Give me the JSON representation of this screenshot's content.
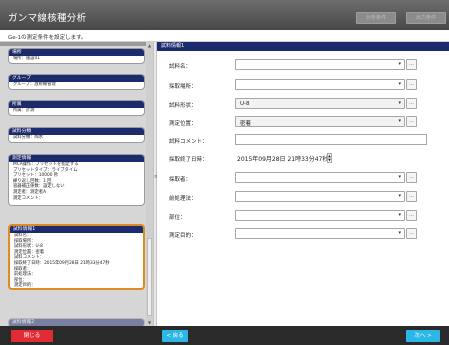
{
  "header": {
    "title": "ガンマ線核種分析",
    "buttons": [
      "分析条件",
      "出力条件"
    ]
  },
  "subheader": "Ge-1の測定条件を設定します。",
  "left_panel": {
    "cards": [
      {
        "title": "場所",
        "lines": [
          "場所：施設01"
        ]
      },
      {
        "title": "グループ",
        "lines": [
          "グループ：放射線管理"
        ]
      },
      {
        "title": "所属",
        "lines": [
          "所属：計測"
        ]
      },
      {
        "title": "試料分類",
        "lines": [
          "試料分類：陶水"
        ]
      },
      {
        "title": "測定情報",
        "lines": [
          "MCA操作：プリセットを指定する",
          "プリセットタイプ：ライブタイム",
          "プリセット：10000 秒",
          "繰り返し回数：1 回",
          "容器補正係数：設定しない",
          "測定者：測定者A",
          "測定コメント："
        ]
      },
      {
        "title": "試料情報1",
        "lines": [
          "試料名：",
          "採取場所：",
          "試料形状：U-8",
          "測定位置：密着",
          "試料コメント：",
          "採取終了日時：2015年09月28日 21時33分47秒",
          "採取者：",
          "前処理法：",
          "部位：",
          "測定目的："
        ]
      },
      {
        "title": "試料情報2",
        "lines": []
      }
    ]
  },
  "right_panel": {
    "title": "試料情報1",
    "fields": [
      {
        "label": "試料名：",
        "value": ""
      },
      {
        "label": "採取場所：",
        "value": ""
      },
      {
        "label": "試料形状：",
        "value": "U-8"
      },
      {
        "label": "測定位置：",
        "value": "密着"
      },
      {
        "label": "試料コメント：",
        "value": ""
      },
      {
        "label": "採取終了日時：",
        "value": "2015年09月28日 21時33分47秒"
      },
      {
        "label": "採取者：",
        "value": ""
      },
      {
        "label": "前処理法：",
        "value": ""
      },
      {
        "label": "部位：",
        "value": ""
      },
      {
        "label": "測定目的：",
        "value": ""
      }
    ],
    "dots_label": "...",
    "caret": "▾",
    "spin_up": "▲",
    "spin_down": "▼"
  },
  "footer": {
    "back": "閉じる",
    "prev": "< 戻る",
    "next": "次へ >"
  },
  "colors": {
    "header_bg": "#474747",
    "nav_blue": "#1c2a6e",
    "active_border": "#e08a23",
    "close_red": "#e12b35",
    "nav_cyan": "#2bb8e6"
  }
}
